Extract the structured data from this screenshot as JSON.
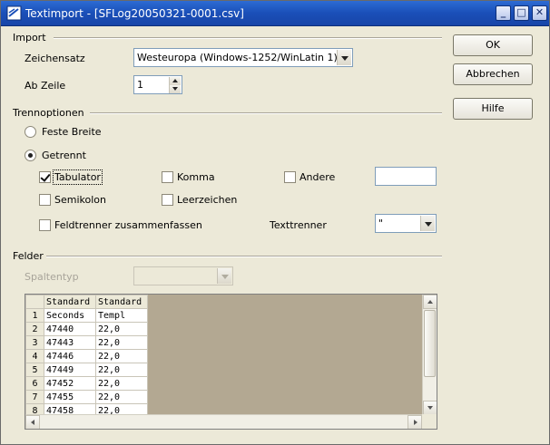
{
  "window": {
    "title": "Textimport - [SFLog20050321-0001.csv]",
    "minimize_glyph": "_",
    "maximize_glyph": "□",
    "close_glyph": "✕"
  },
  "import": {
    "section_label": "Import",
    "charset_label": "Zeichensatz",
    "charset_value": "Westeuropa (Windows-1252/WinLatin 1)",
    "from_row_label": "Ab Zeile",
    "from_row_value": "1"
  },
  "separator_options": {
    "section_label": "Trennoptionen",
    "fixed_width_label": "Feste Breite",
    "separated_label": "Getrennt",
    "mode_selected": "Getrennt",
    "tab_label": "Tabulator",
    "tab_checked": true,
    "comma_label": "Komma",
    "comma_checked": false,
    "other_label": "Andere",
    "other_checked": false,
    "other_value": "",
    "semicolon_label": "Semikolon",
    "semicolon_checked": false,
    "space_label": "Leerzeichen",
    "space_checked": false,
    "merge_label": "Feldtrenner zusammenfassen",
    "merge_checked": false,
    "text_delimiter_label": "Texttrenner",
    "text_delimiter_value": "\""
  },
  "fields": {
    "section_label": "Felder",
    "column_type_label": "Spaltentyp",
    "column_type_value": "",
    "column_headers": [
      "Standard",
      "Standard"
    ],
    "row_numbers": [
      "1",
      "2",
      "3",
      "4",
      "5",
      "6",
      "7",
      "8"
    ],
    "rows": [
      [
        "Seconds",
        "Templ"
      ],
      [
        "47440",
        "22,0"
      ],
      [
        "47443",
        "22,0"
      ],
      [
        "47446",
        "22,0"
      ],
      [
        "47449",
        "22,0"
      ],
      [
        "47452",
        "22,0"
      ],
      [
        "47455",
        "22,0"
      ],
      [
        "47458",
        "22,0"
      ]
    ]
  },
  "buttons": {
    "ok": "OK",
    "cancel": "Abbrechen",
    "help": "Hilfe"
  },
  "colors": {
    "titlebar": "#1a4fb8",
    "dialog_bg": "#ece9d8",
    "grid_bg": "#b3a892"
  }
}
